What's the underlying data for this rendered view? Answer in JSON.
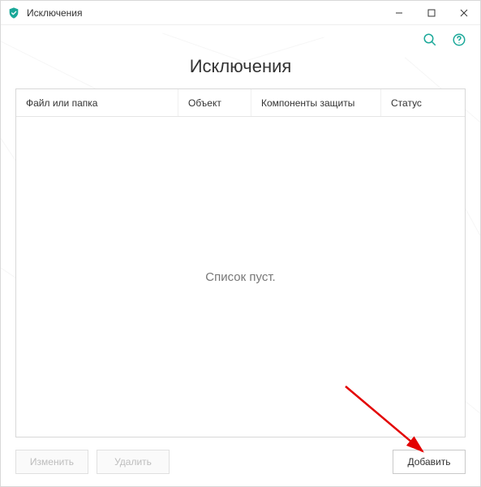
{
  "titlebar": {
    "title": "Исключения"
  },
  "toolbar": {
    "search_icon": "search-icon",
    "help_icon": "help-icon"
  },
  "page": {
    "heading": "Исключения"
  },
  "table": {
    "columns": {
      "file_or_folder": "Файл или папка",
      "object": "Объект",
      "protection_components": "Компоненты защиты",
      "status": "Статус"
    },
    "empty_message": "Список пуст.",
    "rows": []
  },
  "footer": {
    "edit_label": "Изменить",
    "delete_label": "Удалить",
    "add_label": "Добавить"
  },
  "colors": {
    "accent": "#1aa899"
  }
}
